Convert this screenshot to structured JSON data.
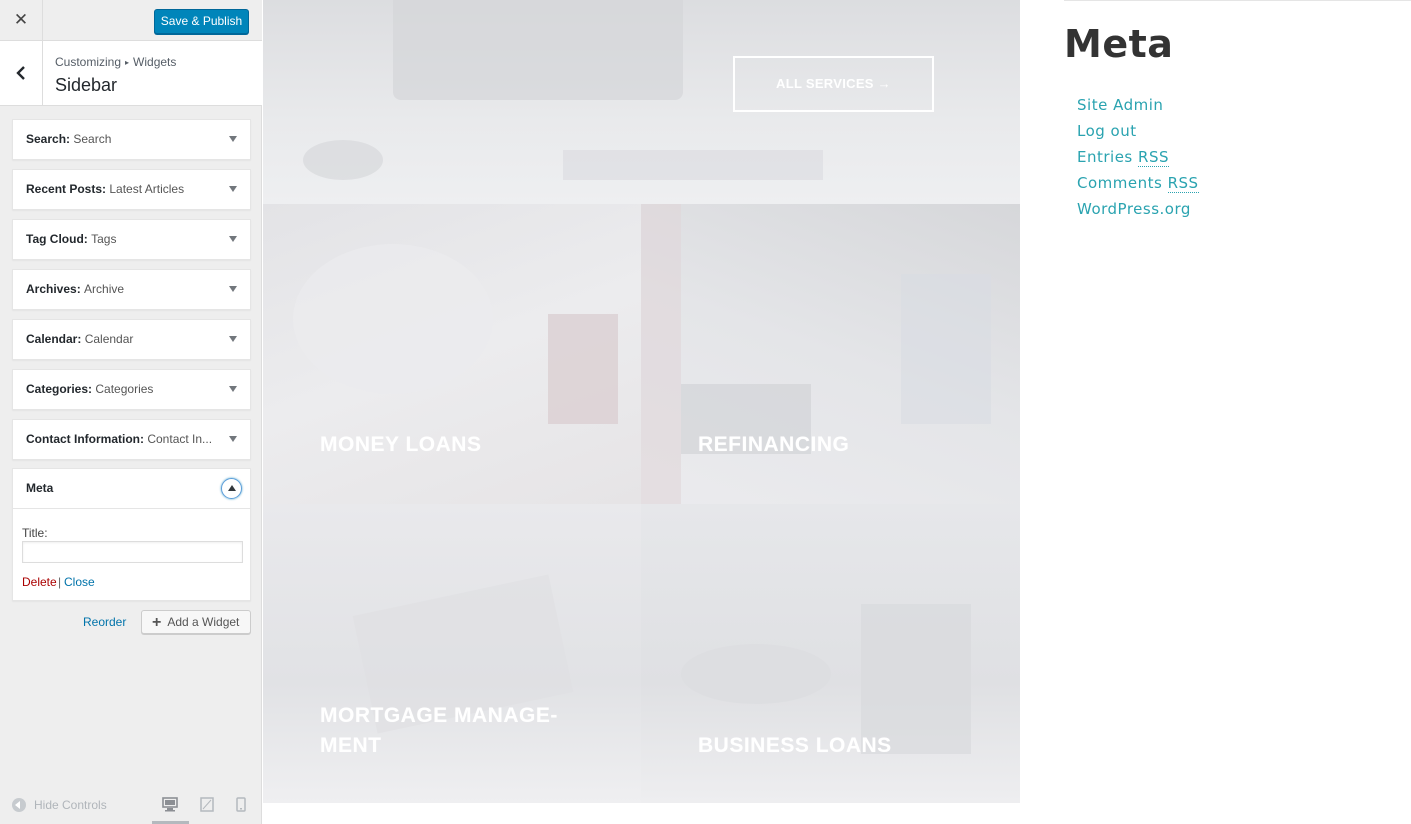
{
  "topbar": {
    "close_label": "✕",
    "publish_label": "Save & Publish"
  },
  "section": {
    "crumb_parent": "Customizing",
    "crumb_sep": "▸",
    "crumb_child": "Widgets",
    "title": "Sidebar"
  },
  "widgets": [
    {
      "type": "Search",
      "title": "Search"
    },
    {
      "type": "Recent Posts",
      "title": "Latest Articles"
    },
    {
      "type": "Tag Cloud",
      "title": "Tags"
    },
    {
      "type": "Archives",
      "title": "Archive"
    },
    {
      "type": "Calendar",
      "title": "Calendar"
    },
    {
      "type": "Categories",
      "title": "Categories"
    },
    {
      "type": "Contact Information",
      "title": "Contact In..."
    }
  ],
  "meta_widget": {
    "type": "Meta",
    "title_label": "Title:",
    "title_value": "",
    "delete_label": "Delete",
    "separator": "|",
    "close_label": "Close"
  },
  "actions": {
    "reorder_label": "Reorder",
    "add_widget_label": "Add a Widget"
  },
  "footer": {
    "hide_controls_label": "Hide Controls"
  },
  "preview": {
    "all_services_label": "ALL SERVICES →",
    "services": {
      "money": "MONEY LOANS",
      "refi": "REFINANCING",
      "mort_line1": "MORTGAGE MANAGE-",
      "mort_line2": "MENT",
      "biz": "BUSINESS LOANS"
    }
  },
  "meta_section": {
    "heading": "Meta",
    "links": {
      "site_admin": "Site Admin",
      "log_out": "Log out",
      "entries": "Entries",
      "comments": "Comments",
      "rss": "RSS",
      "wordpress": "WordPress.org"
    }
  },
  "colors": {
    "publish_button": "#0085ba",
    "link_accent": "#2aa3b0",
    "delete_link": "#aa0000",
    "wp_link": "#0073aa"
  }
}
